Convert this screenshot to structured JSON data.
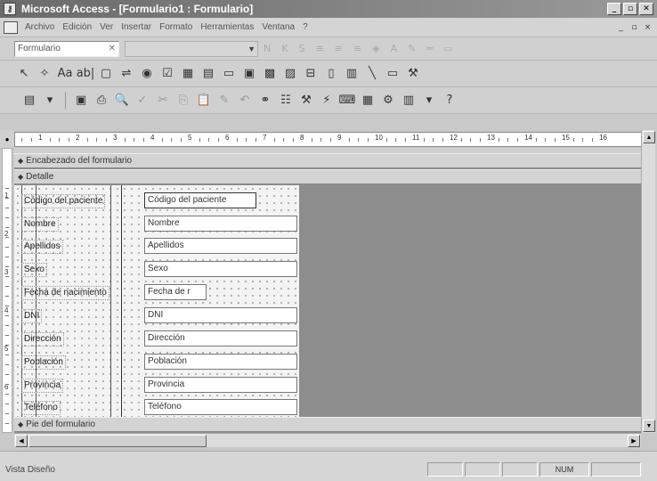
{
  "window": {
    "title": "Microsoft Access - [Formulario1 : Formulario]",
    "app_icon": "access-key-icon",
    "minimize": "_",
    "restore": "▫",
    "close": "✕"
  },
  "menubar": {
    "items": [
      "Archivo",
      "Edición",
      "Ver",
      "Insertar",
      "Formato",
      "Herramientas",
      "Ventana",
      "?"
    ],
    "doc_min": "_",
    "doc_restore": "▫",
    "doc_close": "×"
  },
  "format_toolbar": {
    "object_combo": "Formulario",
    "object_combo_clear": "✕"
  },
  "ruler": {
    "numbers": [
      "1",
      "2",
      "3",
      "4",
      "5",
      "6",
      "7",
      "8",
      "9",
      "10",
      "11",
      "12",
      "13",
      "14",
      "15",
      "16"
    ]
  },
  "form": {
    "header_band": "Encabezado del formulario",
    "detail_band": "Detalle",
    "footer_band": "Pie del formulario",
    "fields": [
      {
        "label": "Código del paciente",
        "value": "Código del paciente"
      },
      {
        "label": "Nombre",
        "value": "Nombre"
      },
      {
        "label": "Apellidos",
        "value": "Apellidos"
      },
      {
        "label": "Sexo",
        "value": "Sexo"
      },
      {
        "label": "Fecha de nacimiento",
        "value": "Fecha de r"
      },
      {
        "label": "DNI",
        "value": "DNI"
      },
      {
        "label": "Dirección",
        "value": "Dirección"
      },
      {
        "label": "Población",
        "value": "Población"
      },
      {
        "label": "Provincia",
        "value": "Provincia"
      },
      {
        "label": "Teléfono",
        "value": "Teléfono"
      }
    ]
  },
  "status": {
    "view": "Vista Diseño",
    "num": "NUM"
  }
}
